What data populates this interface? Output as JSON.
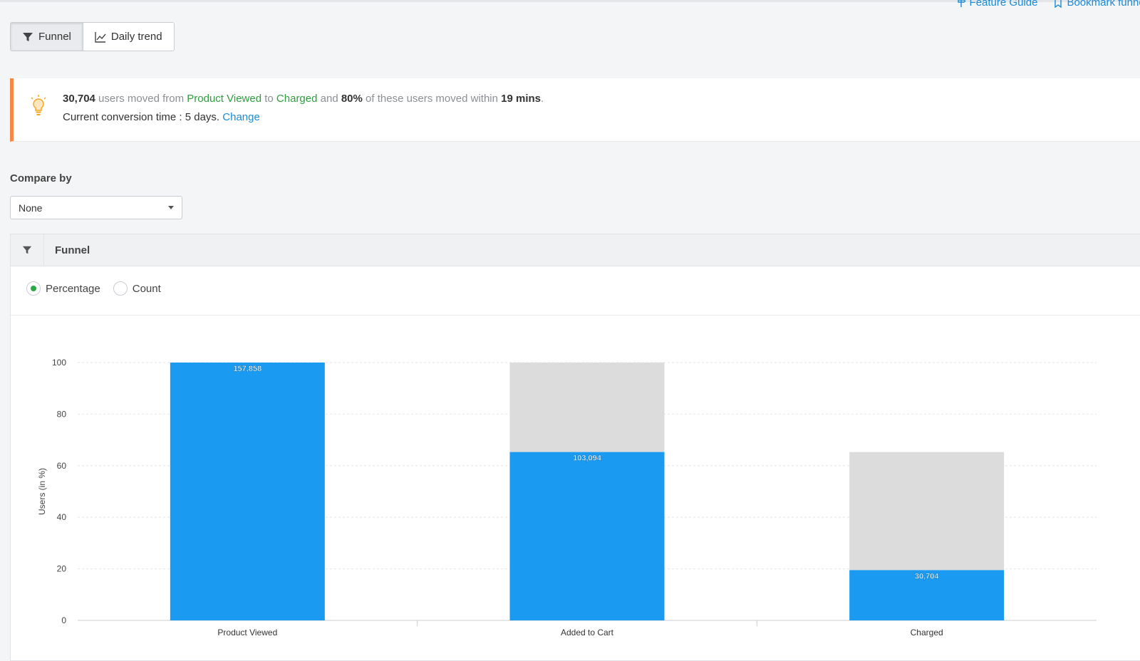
{
  "top_links": {
    "feature_guide": "Feature Guide",
    "bookmark": "Bookmark funnel"
  },
  "view_toggle": {
    "funnel": "Funnel",
    "daily_trend": "Daily trend"
  },
  "insight": {
    "users": "30,704",
    "text1": " users moved from ",
    "from_event": "Product Viewed",
    "text2": " to ",
    "to_event": "Charged",
    "text3": " and ",
    "percent": "80%",
    "text4": " of these users moved within ",
    "duration": "19 mins",
    "text5": ".",
    "conversion_text": "Current conversion time : 5 days. ",
    "change_link": "Change"
  },
  "compare_by": {
    "label": "Compare by",
    "selected": "None"
  },
  "panel": {
    "title": "Funnel"
  },
  "radios": {
    "percentage": "Percentage",
    "count": "Count",
    "selected": "Percentage"
  },
  "colors": {
    "bar": "#1a9af0",
    "remainder": "#dcdcdc",
    "accent": "#2aa843",
    "link": "#1a8bd6",
    "banner_accent": "#f58a47"
  },
  "chart_data": {
    "type": "bar",
    "ylabel": "Users (in %)",
    "ylim": [
      0,
      100
    ],
    "yticks": [
      0,
      20,
      40,
      60,
      80,
      100
    ],
    "categories": [
      "Product Viewed",
      "Added to Cart",
      "Charged"
    ],
    "values": [
      100,
      65.3,
      19.5
    ],
    "previous_step": [
      100,
      100,
      65.3
    ],
    "labels": [
      "157,858",
      "103,094",
      "30,704"
    ],
    "grid": true
  }
}
